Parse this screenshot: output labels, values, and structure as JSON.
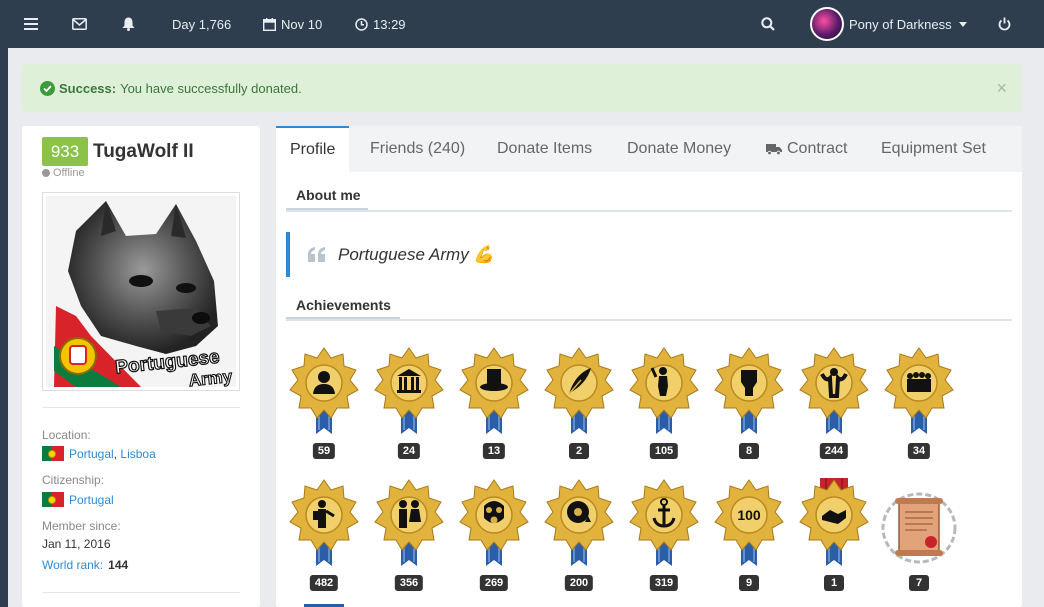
{
  "topbar": {
    "day": "Day 1,766",
    "date": "Nov 10",
    "time": "13:29",
    "user_name": "Pony of Darkness",
    "icons": [
      "menu-icon",
      "mail-icon",
      "bell-icon",
      "calendar-icon",
      "clock-icon",
      "search-icon",
      "power-icon"
    ]
  },
  "alert": {
    "title": "Success:",
    "message": "You have successfully donated.",
    "close": "×"
  },
  "profile": {
    "level": "933",
    "name": "TugaWolf II",
    "status": "Offline",
    "location_label": "Location:",
    "location_country": "Portugal",
    "location_sep": ",",
    "location_region": "Lisboa",
    "citizenship_label": "Citizenship:",
    "citizenship": "Portugal",
    "member_since_label": "Member since:",
    "member_since": "Jan 11, 2016",
    "world_rank_label": "World rank:",
    "world_rank": "144",
    "photo_text_line1": "Portuguese",
    "photo_text_line2": "Army"
  },
  "tabs": [
    {
      "label": "Profile",
      "active": true
    },
    {
      "label": "Friends (240)"
    },
    {
      "label": "Donate Items"
    },
    {
      "label": "Donate Money"
    },
    {
      "label": "Contract",
      "icon": "truck-icon"
    },
    {
      "label": "Equipment Set"
    }
  ],
  "about": {
    "title": "About me",
    "quote": "Portuguese Army 💪"
  },
  "achievements": {
    "title": "Achievements",
    "items": [
      {
        "icon": "citizen-icon",
        "count": "59"
      },
      {
        "icon": "congress-icon",
        "count": "24"
      },
      {
        "icon": "top-hat-icon",
        "count": "13"
      },
      {
        "icon": "feather-icon",
        "count": "2"
      },
      {
        "icon": "soldier-icon",
        "count": "105"
      },
      {
        "icon": "fist-icon",
        "count": "8"
      },
      {
        "icon": "strongman-icon",
        "count": "244"
      },
      {
        "icon": "army-icon",
        "count": "34"
      },
      {
        "icon": "defender-icon",
        "count": "482"
      },
      {
        "icon": "couple-icon",
        "count": "356"
      },
      {
        "icon": "gas-mask-icon",
        "count": "269"
      },
      {
        "icon": "brain-icon",
        "count": "200"
      },
      {
        "icon": "anchor-icon",
        "count": "319"
      },
      {
        "icon": "hundred-icon",
        "count": "9",
        "text": "100"
      },
      {
        "icon": "handshake-medal-icon",
        "count": "1"
      },
      {
        "icon": "scroll-icon",
        "count": "7"
      }
    ]
  },
  "colors": {
    "topbar": "#2f3e4e",
    "accent": "#2b8bd8",
    "level": "#8bc34a",
    "success_bg": "#dff0d8",
    "success_text": "#3c763d",
    "gold": "#e1b33c",
    "ribbon": "#2b5ea8"
  }
}
